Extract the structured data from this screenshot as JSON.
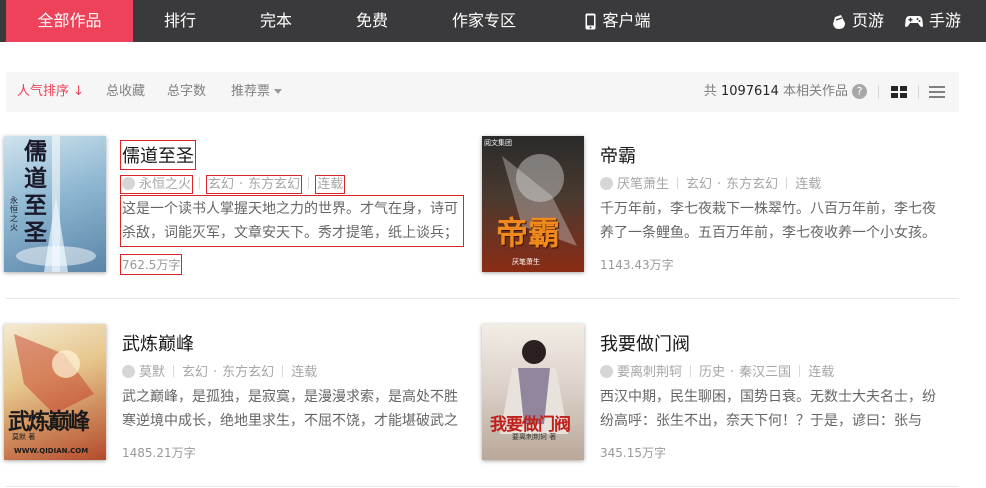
{
  "nav": {
    "items": [
      "全部作品",
      "排行",
      "完本",
      "免费",
      "作家专区"
    ],
    "client": "客户端",
    "web_game": "页游",
    "mobile_game": "手游"
  },
  "sortbar": {
    "items": [
      "人气排序",
      "总收藏",
      "总字数",
      "推荐票"
    ],
    "active_arrow": "↓",
    "count_prefix": "共",
    "count": "1097614",
    "count_suffix": "本相关作品",
    "help": "?"
  },
  "books": [
    {
      "title": "儒道至圣",
      "author": "永恒之火",
      "category": "玄幻",
      "subcategory": "东方玄幻",
      "status": "连载",
      "intro": "这是一个读书人掌握天地之力的世界。才气在身，诗可杀敌，词能灭军，文章安天下。秀才提笔，纸上谈兵；",
      "words": "762.5万字",
      "cover_text": "儒道至圣",
      "cover_sub": "永恒之火"
    },
    {
      "title": "帝霸",
      "author": "厌笔萧生",
      "category": "玄幻",
      "subcategory": "东方玄幻",
      "status": "连载",
      "intro": "千万年前，李七夜栽下一株翠竹。八百万年前，李七夜养了一条鲤鱼。五百万年前，李七夜收养一个小女孩。",
      "words": "1143.43万字",
      "cover_text": "帝霸",
      "cover_top": "阅文集团",
      "cover_sub": "厌笔萧生"
    },
    {
      "title": "武炼巅峰",
      "author": "莫默",
      "category": "玄幻",
      "subcategory": "东方玄幻",
      "status": "连载",
      "intro": "武之巅峰，是孤独，是寂寞，是漫漫求索，是高处不胜寒逆境中成长，绝地里求生，不屈不饶，才能堪破武之",
      "words": "1485.21万字",
      "cover_text": "武炼巅峰",
      "cover_sub": "莫默 著",
      "cover_url": "WWW.QIDIAN.COM"
    },
    {
      "title": "我要做门阀",
      "author": "要离刺荆轲",
      "category": "历史",
      "subcategory": "秦汉三国",
      "status": "连载",
      "intro": "西汉中期，民生聊困，国势日衰。无数士大夫名士，纷纷高呼：张生不出，奈天下何！？于是，谚曰：张与",
      "words": "345.15万字",
      "cover_text": "我要做门阀",
      "cover_sub": "要离刺荆轲 著"
    }
  ],
  "colors": {
    "accent": "#ed4259",
    "nav_bg": "#3a3a3c",
    "highlight_box": "#d8262a"
  }
}
